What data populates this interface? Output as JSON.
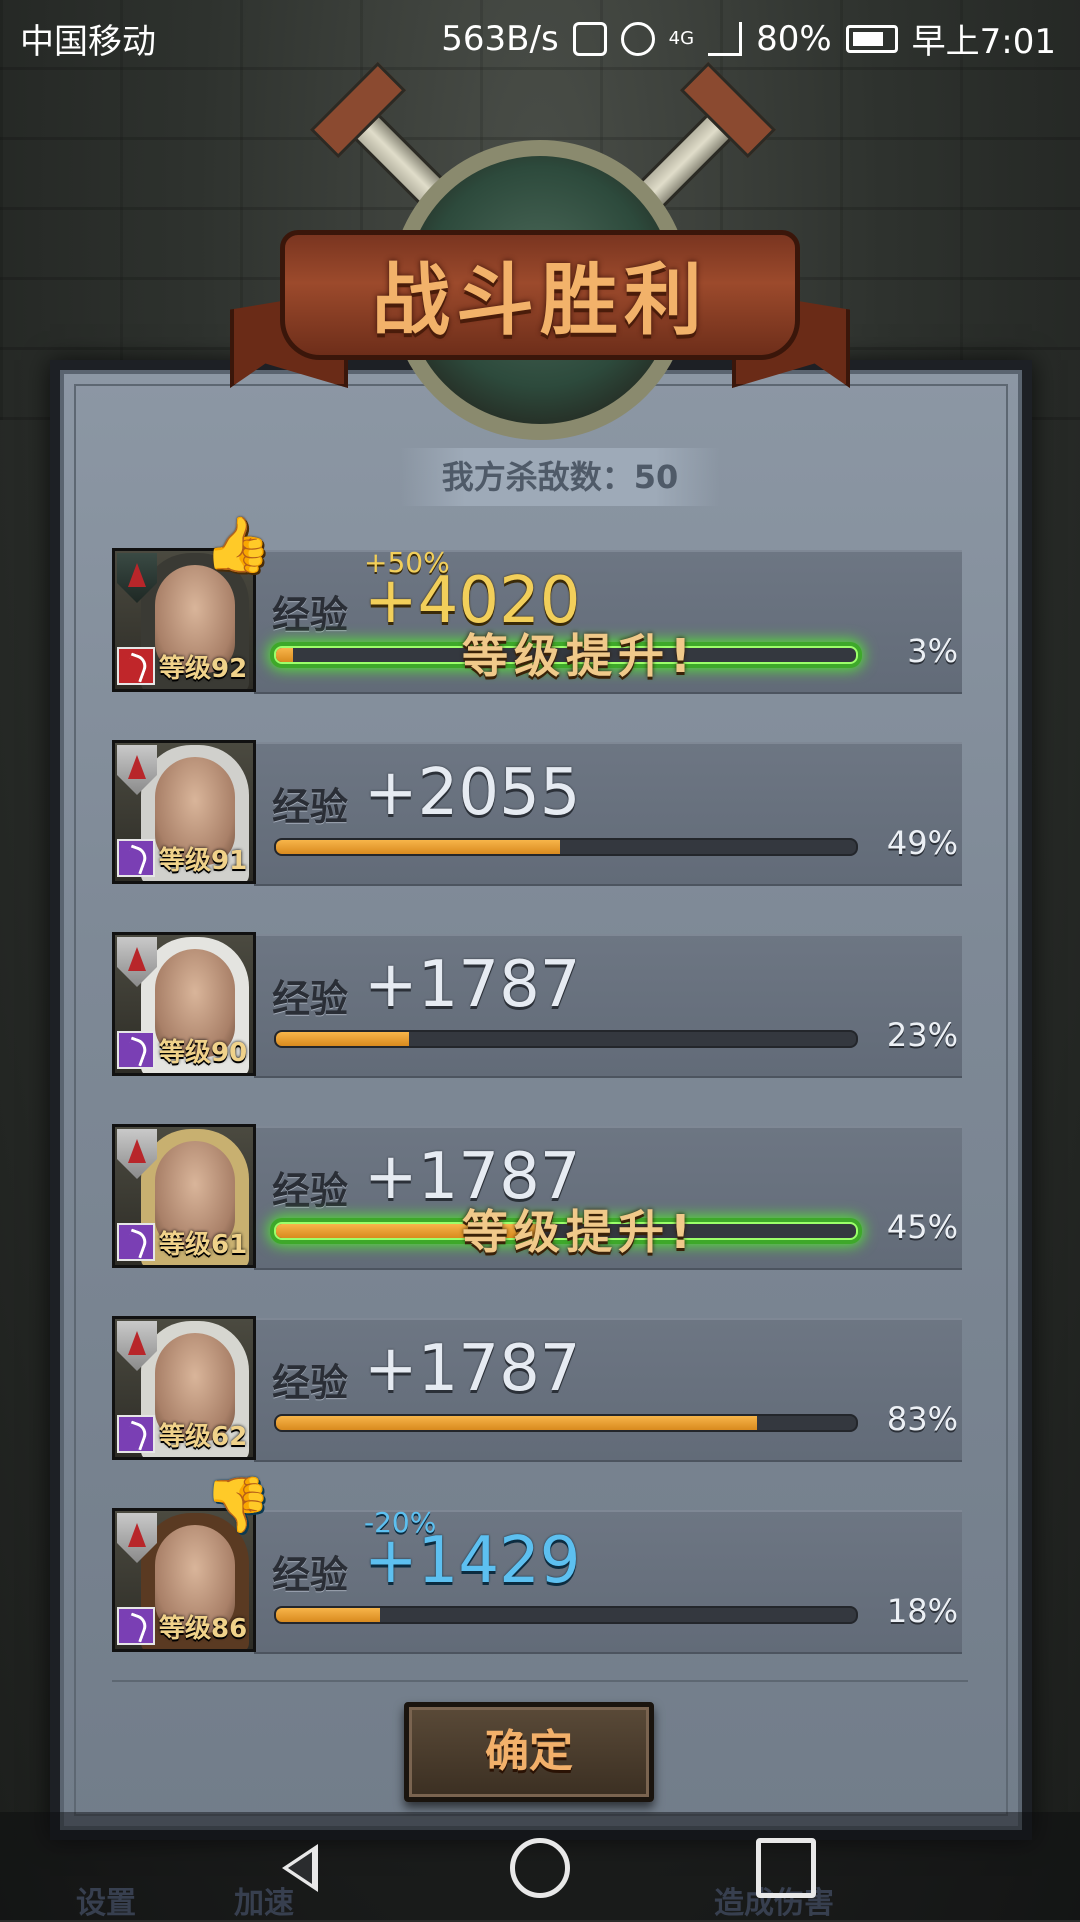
{
  "status_bar": {
    "carrier": "中国移动",
    "speed": "563B/s",
    "network": "4G",
    "battery": "80%",
    "time": "早上7:01"
  },
  "dialog": {
    "title": "战斗胜利",
    "kill_count": "我方杀敌数：50",
    "exp_label": "经验",
    "level_up_text": "等级提升!",
    "confirm_label": "确定"
  },
  "heroes": [
    {
      "level": "等级92",
      "exp": "+4020",
      "bonus": "+50%",
      "progress_label": "3%",
      "progress": 0.03,
      "level_up": true,
      "highlight": "up",
      "weapon_color": "#c0262a"
    },
    {
      "level": "等级91",
      "exp": "+2055",
      "bonus": "",
      "progress_label": "49%",
      "progress": 0.49,
      "level_up": false,
      "highlight": "",
      "weapon_color": "#7a3fb4"
    },
    {
      "level": "等级90",
      "exp": "+1787",
      "bonus": "",
      "progress_label": "23%",
      "progress": 0.23,
      "level_up": false,
      "highlight": "",
      "weapon_color": "#7a3fb4"
    },
    {
      "level": "等级61",
      "exp": "+1787",
      "bonus": "",
      "progress_label": "45%",
      "progress": 0.45,
      "level_up": true,
      "highlight": "",
      "weapon_color": "#7a3fb4"
    },
    {
      "level": "等级62",
      "exp": "+1787",
      "bonus": "",
      "progress_label": "83%",
      "progress": 0.83,
      "level_up": false,
      "highlight": "",
      "weapon_color": "#7a3fb4"
    },
    {
      "level": "等级86",
      "exp": "+1429",
      "bonus": "-20%",
      "progress_label": "18%",
      "progress": 0.18,
      "level_up": false,
      "highlight": "down",
      "weapon_color": "#7a3fb4"
    }
  ],
  "game_menu": {
    "settings": "设置",
    "speed_up": "加速",
    "damage": "造成伤害"
  },
  "icons": {
    "thumbs_up": "thumbs-up-icon",
    "thumbs_down": "thumbs-down-icon",
    "back": "back-icon",
    "home": "home-icon",
    "recent": "recent-apps-icon"
  },
  "colors": {
    "exp_bar": "#f0a53a",
    "level_up_glow": "#56e03a",
    "bonus_positive": "#f2cf5a",
    "bonus_negative": "#5dc0f0"
  }
}
